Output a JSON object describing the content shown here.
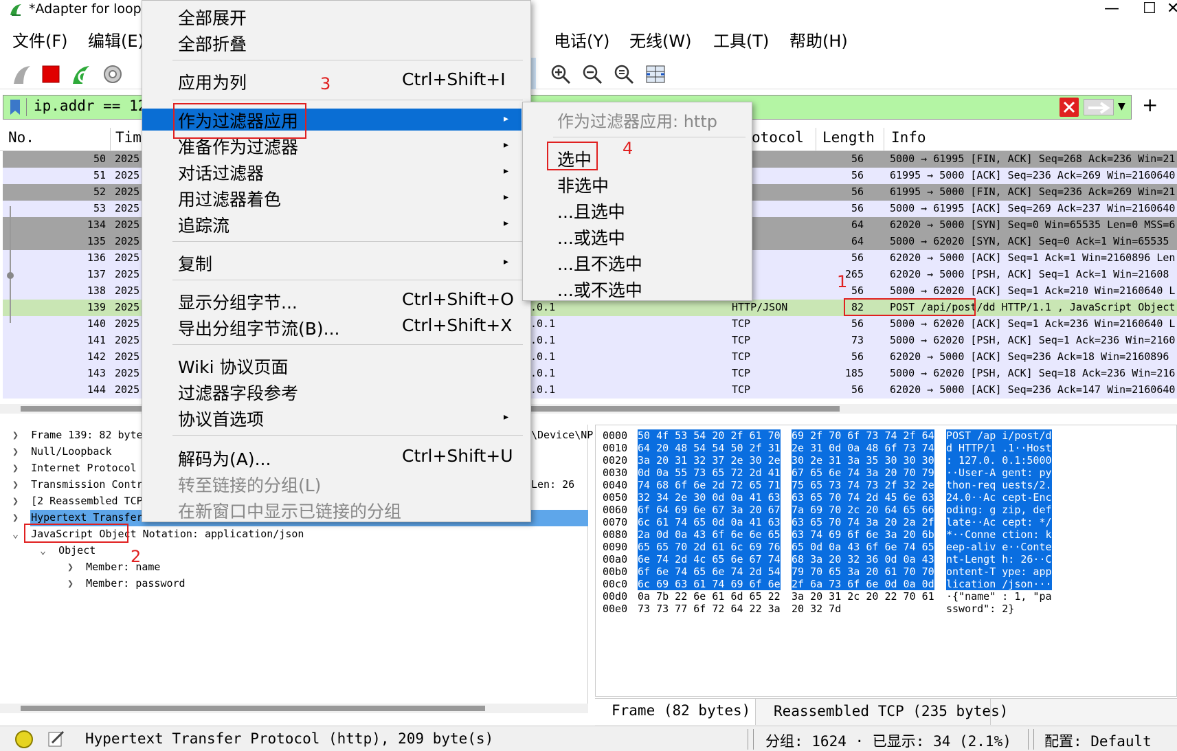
{
  "window": {
    "title": "*Adapter for loopb",
    "min_glyph": "—",
    "max_glyph": "☐",
    "close_glyph": "✕"
  },
  "menubar": {
    "file": "文件(F)",
    "edit": "编辑(E)",
    "telephony": "电话(Y)",
    "wireless": "无线(W)",
    "tools": "工具(T)",
    "help": "帮助(H)"
  },
  "filter": {
    "text": "ip.addr == 12"
  },
  "columns": {
    "no": "No.",
    "time": "Tim",
    "protocol": "otocol",
    "length": "Length",
    "info": "Info"
  },
  "packets": [
    {
      "no": "50",
      "time": "2025",
      "src": "",
      "proto": "",
      "len": "56",
      "info": "5000 → 61995 [FIN, ACK] Seq=268 Ack=236 Win=21"
    },
    {
      "no": "51",
      "time": "2025",
      "src": "",
      "proto": "",
      "len": "56",
      "info": "61995 → 5000 [ACK] Seq=236 Ack=269 Win=2160640"
    },
    {
      "no": "52",
      "time": "2025",
      "src": "",
      "proto": "",
      "len": "56",
      "info": "61995 → 5000 [FIN, ACK] Seq=236 Ack=269 Win=21"
    },
    {
      "no": "53",
      "time": "2025",
      "src": "",
      "proto": "",
      "len": "56",
      "info": "5000 → 61995 [ACK] Seq=269 Ack=237 Win=2160640"
    },
    {
      "no": "134",
      "time": "2025",
      "src": "",
      "proto": "",
      "len": "64",
      "info": "62020 → 5000 [SYN] Seq=0 Win=65535 Len=0 MSS=6"
    },
    {
      "no": "135",
      "time": "2025",
      "src": "",
      "proto": "",
      "len": "64",
      "info": "5000 → 62020 [SYN, ACK] Seq=0 Ack=1 Win=65535"
    },
    {
      "no": "136",
      "time": "2025",
      "src": "",
      "proto": "",
      "len": "56",
      "info": "62020 → 5000 [ACK] Seq=1 Ack=1 Win=2160896 Len"
    },
    {
      "no": "137",
      "time": "2025",
      "src": "",
      "proto": "",
      "len": "265",
      "info": "62020 → 5000 [PSH, ACK] Seq=1 Ack=1 Win=21608"
    },
    {
      "no": "138",
      "time": "2025",
      "src": "",
      "proto": "",
      "len": "56",
      "info": "5000 → 62020 [ACK] Seq=1 Ack=210 Win=2160640 L"
    },
    {
      "no": "139",
      "time": "2025",
      "src": ".0.1",
      "proto": "HTTP/JSON",
      "len": "82",
      "info": "POST /api/post/dd HTTP/1.1 , JavaScript Object"
    },
    {
      "no": "140",
      "time": "2025",
      "src": ".0.1",
      "proto": "TCP",
      "len": "56",
      "info": "5000 → 62020 [ACK] Seq=1 Ack=236 Win=2160640 L"
    },
    {
      "no": "141",
      "time": "2025",
      "src": ".0.1",
      "proto": "TCP",
      "len": "73",
      "info": "5000 → 62020 [PSH, ACK] Seq=1 Ack=236 Win=2160"
    },
    {
      "no": "142",
      "time": "2025",
      "src": ".0.1",
      "proto": "TCP",
      "len": "56",
      "info": "62020 → 5000 [ACK] Seq=236 Ack=18 Win=2160896"
    },
    {
      "no": "143",
      "time": "2025",
      "src": ".0.1",
      "proto": "TCP",
      "len": "185",
      "info": "5000 → 62020 [PSH, ACK] Seq=18 Ack=236 Win=216"
    },
    {
      "no": "144",
      "time": "2025",
      "src": ".0.1",
      "proto": "TCP",
      "len": "56",
      "info": "62020 → 5000 [ACK] Seq=236 Ack=147 Win=2160640"
    }
  ],
  "details": {
    "frame": "Frame 139: 82 byte",
    "frame_tail": "\\Device\\NP",
    "null": "Null/Loopback",
    "ip": "Internet Protocol",
    "tcp": "Transmission Contr",
    "tcp_tail": "Len: 26",
    "reassembled": "[2 Reassembled TCP",
    "http": "Hypertext Transfer",
    "json": "JavaScript Object Notation: application/json",
    "object": "Object",
    "member_name": "Member: name",
    "member_password": "Member: password"
  },
  "hex": {
    "offsets": [
      "0000",
      "0010",
      "0020",
      "0030",
      "0040",
      "0050",
      "0060",
      "0070",
      "0080",
      "0090",
      "00a0",
      "00b0",
      "00c0",
      "00d0",
      "00e0"
    ],
    "bytes1": [
      "50 4f 53 54 20 2f 61 70",
      "64 20 48 54 54 50 2f 31",
      "3a 20 31 32 37 2e 30 2e",
      "0d 0a 55 73 65 72 2d 41",
      "74 68 6f 6e 2d 72 65 71",
      "32 34 2e 30 0d 0a 41 63",
      "6f 64 69 6e 67 3a 20 67",
      "6c 61 74 65 0d 0a 41 63",
      "2a 0d 0a 43 6f 6e 6e 65",
      "65 65 70 2d 61 6c 69 76",
      "6e 74 2d 4c 65 6e 67 74",
      "6f 6e 74 65 6e 74 2d 54",
      "6c 69 63 61 74 69 6f 6e",
      "0a 7b 22 6e 61 6d 65 22",
      "73 73 77 6f 72 64 22 3a"
    ],
    "bytes2": [
      "69 2f 70 6f 73 74 2f 64",
      "2e 31 0d 0a 48 6f 73 74",
      "30 2e 31 3a 35 30 30 30",
      "67 65 6e 74 3a 20 70 79",
      "75 65 73 74 73 2f 32 2e",
      "63 65 70 74 2d 45 6e 63",
      "7a 69 70 2c 20 64 65 66",
      "63 65 70 74 3a 20 2a 2f",
      "63 74 69 6f 6e 3a 20 6b",
      "65 0d 0a 43 6f 6e 74 65",
      "68 3a 20 32 36 0d 0a 43",
      "79 70 65 3a 20 61 70 70",
      "2f 6a 73 6f 6e 0d 0a 0d",
      "3a 20 31 2c 20 22 70 61",
      "20 32 7d"
    ],
    "ascii": [
      "POST /ap i/post/d",
      "d HTTP/1 .1··Host",
      ": 127.0. 0.1:5000",
      "··User-A gent: py",
      "thon-req uests/2.",
      "24.0··Ac cept-Enc",
      "oding: g zip, def",
      "late··Ac cept: */",
      "*··Conne ction: k",
      "eep-aliv e··Conte",
      "nt-Lengt h: 26··C",
      "ontent-T ype: app",
      "lication /json···",
      "·{\"name\" : 1, \"pa",
      "ssword\":  2}"
    ],
    "tab_frame": "Frame (82 bytes)",
    "tab_reassembled": "Reassembled TCP (235 bytes)"
  },
  "statusbar": {
    "text": "Hypertext Transfer Protocol (http), 209 byte(s)",
    "packets": "分组: 1624 · 已显示: 34 (2.1%)",
    "profile": "配置: Default"
  },
  "context_menu": {
    "expand_all": "全部展开",
    "collapse_all": "全部折叠",
    "apply_as_column": "应用为列",
    "apply_as_column_sc": "Ctrl+Shift+I",
    "apply_as_filter": "作为过滤器应用",
    "prepare_filter": "准备作为过滤器",
    "conversation_filter": "对话过滤器",
    "colorize": "用过滤器着色",
    "follow_stream": "追踪流",
    "copy": "复制",
    "show_bytes": "显示分组字节...",
    "show_bytes_sc": "Ctrl+Shift+O",
    "export_bytes": "导出分组字节流(B)...",
    "export_bytes_sc": "Ctrl+Shift+X",
    "wiki": "Wiki 协议页面",
    "field_ref": "过滤器字段参考",
    "protocol_prefs": "协议首选项",
    "decode_as": "解码为(A)...",
    "decode_as_sc": "Ctrl+Shift+U",
    "goto_linked": "转至链接的分组(L)",
    "show_linked_new": "在新窗口中显示已链接的分组"
  },
  "submenu": {
    "header": "作为过滤器应用: http",
    "selected": "选中",
    "not_selected": "非选中",
    "and_selected": "...且选中",
    "or_selected": "...或选中",
    "and_not_selected": "...且不选中",
    "or_not_selected": "...或不选中"
  },
  "annotations": {
    "n1": "1",
    "n2": "2",
    "n3": "3",
    "n4": "4"
  }
}
